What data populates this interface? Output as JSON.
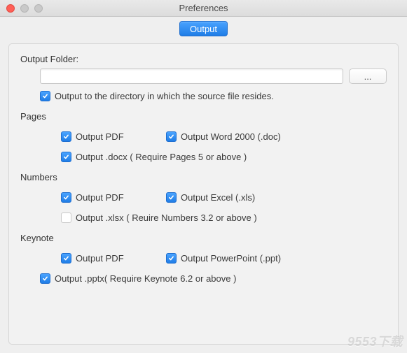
{
  "window": {
    "title": "Preferences"
  },
  "toolbar": {
    "output_tab": "Output"
  },
  "output_folder": {
    "label": "Output Folder:",
    "path": "",
    "browse_label": "...",
    "same_dir_checked": true,
    "same_dir_label": "Output to the directory in which the source file resides."
  },
  "pages": {
    "header": "Pages",
    "pdf": {
      "checked": true,
      "label": "Output PDF"
    },
    "doc": {
      "checked": true,
      "label": "Output Word 2000 (.doc)"
    },
    "docx": {
      "checked": true,
      "label": "Output .docx ( Require Pages 5 or above )"
    }
  },
  "numbers": {
    "header": "Numbers",
    "pdf": {
      "checked": true,
      "label": "Output PDF"
    },
    "xls": {
      "checked": true,
      "label": "Output Excel (.xls)"
    },
    "xlsx": {
      "checked": false,
      "label": "Output .xlsx ( Reuire Numbers 3.2 or above )"
    }
  },
  "keynote": {
    "header": "Keynote",
    "pdf": {
      "checked": true,
      "label": "Output PDF"
    },
    "ppt": {
      "checked": true,
      "label": "Output PowerPoint (.ppt)"
    },
    "pptx": {
      "checked": true,
      "label": "Output .pptx( Require Keynote 6.2 or above )"
    }
  },
  "watermark": "9553下载"
}
